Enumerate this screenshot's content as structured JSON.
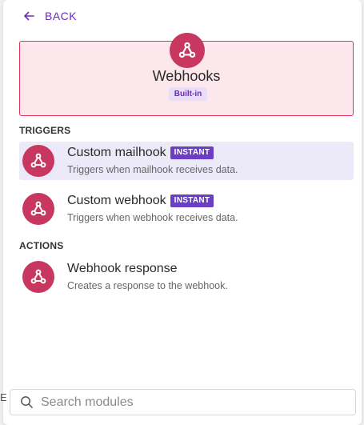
{
  "nav": {
    "back_label": "BACK"
  },
  "app": {
    "title": "Webhooks",
    "badge": "Built-in"
  },
  "sections": {
    "triggers": "TRIGGERS",
    "actions": "ACTIONS"
  },
  "modules": [
    {
      "name": "Custom mailhook",
      "badge": "INSTANT",
      "description": "Triggers when mailhook receives data."
    },
    {
      "name": "Custom webhook",
      "badge": "INSTANT",
      "description": "Triggers when webhook receives data."
    },
    {
      "name": "Webhook response",
      "description": "Creates a response to the webhook."
    }
  ],
  "search": {
    "placeholder": "Search modules"
  },
  "edge_mark": "E",
  "colors": {
    "accent": "#6b2bbf",
    "brand": "#c7375f",
    "instant": "#6b3fc4"
  }
}
